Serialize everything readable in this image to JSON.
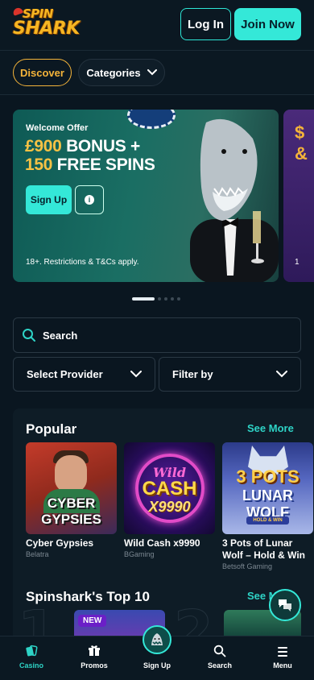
{
  "header": {
    "logo_top": "SPIN",
    "logo_bottom": "SHARK",
    "login_label": "Log In",
    "join_label": "Join Now"
  },
  "subnav": {
    "discover_label": "Discover",
    "categories_label": "Categories"
  },
  "hero": {
    "label": "Welcome Offer",
    "line1_amount": "£900",
    "line1_rest": " BONUS +",
    "line2_amount": "150",
    "line2_rest": " FREE SPINS",
    "signup_label": "Sign Up",
    "info_glyph": "i",
    "terms": "18+. Restrictions & T&Cs apply.",
    "next_peek_1": "$",
    "next_peek_2": "&",
    "next_peek_3": "1"
  },
  "carousel": {
    "slides": 5,
    "active": 0
  },
  "search": {
    "label": "Search"
  },
  "filters": {
    "provider_label": "Select Provider",
    "filter_label": "Filter by"
  },
  "popular": {
    "title": "Popular",
    "see_more": "See More",
    "games": [
      {
        "name": "Cyber Gypsies",
        "provider": "Belatra",
        "art_1": "CYBER",
        "art_2": "GYPSIES"
      },
      {
        "name": "Wild Cash x9990",
        "provider": "BGaming",
        "art_1": "Wild",
        "art_2": "CASH",
        "art_3": "X9990"
      },
      {
        "name": "3 Pots of Lunar Wolf – Hold & Win",
        "provider": "Betsoft Gaming",
        "art_1": "3 POTS",
        "art_2": "LUNAR WOLF",
        "art_3": "HOLD & WIN"
      }
    ]
  },
  "top10": {
    "title": "Spinshark's Top 10",
    "see_more": "See More",
    "new_badge": "NEW",
    "num_1": "1",
    "num_2": "2"
  },
  "bottom_nav": {
    "items": [
      {
        "label": "Casino",
        "icon": "casino-cards-icon"
      },
      {
        "label": "Promos",
        "icon": "gift-icon"
      },
      {
        "label": "Sign Up",
        "icon": "shark-icon"
      },
      {
        "label": "Search",
        "icon": "search-icon"
      },
      {
        "label": "Menu",
        "icon": "menu-icon"
      }
    ]
  },
  "colors": {
    "accent": "#34e8d8",
    "gold": "#f5b43a",
    "background": "#0a1620"
  }
}
